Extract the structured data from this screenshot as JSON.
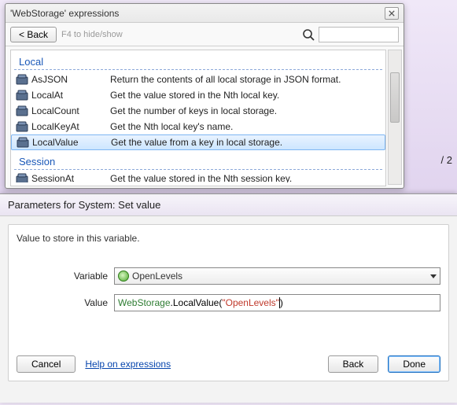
{
  "popup1": {
    "title": "'WebStorage' expressions",
    "back_label": "< Back",
    "hint": "F4 to hide/show",
    "sections": [
      {
        "name": "Local",
        "items": [
          {
            "label": "AsJSON",
            "desc": "Return the contents of all local storage in JSON format."
          },
          {
            "label": "LocalAt",
            "desc": "Get the value stored in the Nth local key."
          },
          {
            "label": "LocalCount",
            "desc": "Get the number of keys in local storage."
          },
          {
            "label": "LocalKeyAt",
            "desc": "Get the Nth local key's name."
          },
          {
            "label": "LocalValue",
            "desc": "Get the value from a key in local storage."
          }
        ],
        "selected_index": 4
      },
      {
        "name": "Session",
        "items": [
          {
            "label": "SessionAt",
            "desc": "Get the value stored in the Nth session key."
          }
        ]
      }
    ]
  },
  "background": {
    "page_label": "/ 2"
  },
  "popup2": {
    "title": "Parameters for System: Set value",
    "description": "Value to store in this variable.",
    "rows": {
      "variable": {
        "label": "Variable",
        "value": "OpenLevels"
      },
      "value": {
        "label": "Value",
        "tokens": {
          "obj": "WebStorage",
          "fn": "LocalValue",
          "str": "\"OpenLevels\""
        }
      }
    },
    "buttons": {
      "cancel": "Cancel",
      "help": "Help on expressions",
      "back": "Back",
      "done": "Done"
    }
  }
}
